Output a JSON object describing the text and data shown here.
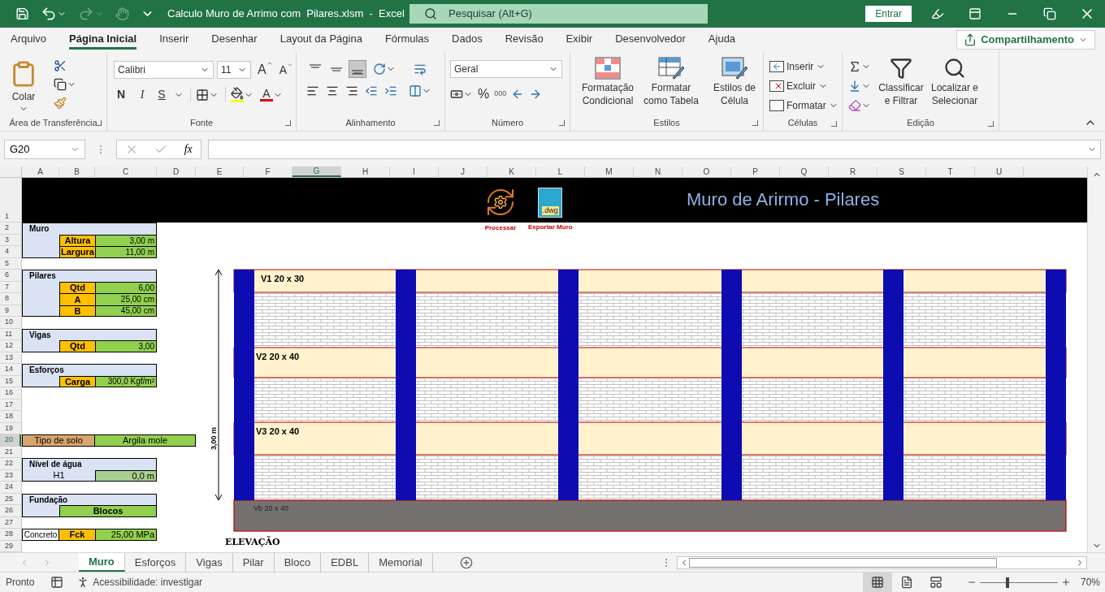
{
  "title_bar": {
    "quick_access": [
      {
        "kind": "save",
        "disabled": false
      },
      {
        "kind": "undo",
        "disabled": false
      },
      {
        "kind": "redo",
        "disabled": true
      },
      {
        "kind": "touch",
        "disabled": true
      },
      {
        "kind": "customize",
        "disabled": false
      }
    ],
    "title": "Calculo Muro de Arrimo com  Pilares.xlsm  -  Excel",
    "search": {
      "placeholder": "Pesquisar (Alt+G)"
    },
    "sign_in": "Entrar"
  },
  "menu_tabs": [
    {
      "label": "Arquivo",
      "selected": false
    },
    {
      "label": "Página Inicial",
      "selected": true
    },
    {
      "label": "Inserir",
      "selected": false
    },
    {
      "label": "Desenhar",
      "selected": false
    },
    {
      "label": "Layout da Página",
      "selected": false
    },
    {
      "label": "Fórmulas",
      "selected": false
    },
    {
      "label": "Dados",
      "selected": false
    },
    {
      "label": "Revisão",
      "selected": false
    },
    {
      "label": "Exibir",
      "selected": false
    },
    {
      "label": "Desenvolvedor",
      "selected": false
    },
    {
      "label": "Ajuda",
      "selected": false
    }
  ],
  "share": "Compartilhamento",
  "ribbon": {
    "clipboard": {
      "paste": "Colar",
      "label": "Área de Transferência"
    },
    "font": {
      "name": "Calibri",
      "size": "11",
      "grow": "A",
      "shrink": "A",
      "bold": "N",
      "italic": "I",
      "underline": "S",
      "color_letter": "A",
      "label": "Fonte"
    },
    "alignment": {
      "vertical": [
        {
          "kind": "top",
          "selected": false
        },
        {
          "kind": "middle",
          "selected": false
        },
        {
          "kind": "bottom",
          "selected": true
        }
      ],
      "label": "Alinhamento"
    },
    "number": {
      "format": "Geral",
      "percent": "%",
      "thousands": "000",
      "label": "Número"
    },
    "styles": {
      "buttons": [
        {
          "kind": "conditional",
          "label": "Formatação Condicional"
        },
        {
          "kind": "table",
          "label": "Formatar como Tabela"
        },
        {
          "kind": "cell",
          "label": "Estilos de Célula"
        }
      ],
      "label": "Estilos"
    },
    "cells": {
      "buttons": [
        {
          "kind": "insert",
          "label": "Inserir"
        },
        {
          "kind": "delete",
          "label": "Excluir"
        },
        {
          "kind": "format",
          "label": "Formatar"
        }
      ],
      "label": "Células"
    },
    "editing": {
      "buttons": [
        {
          "kind": "sort",
          "label": "Classificar e Filtrar"
        },
        {
          "kind": "find",
          "label": "Localizar e Selecionar"
        }
      ],
      "label": "Edição"
    }
  },
  "formula_bar": {
    "name_box": "G20",
    "function_label": "fx"
  },
  "columns": [
    {
      "label": "A",
      "selected": false
    },
    {
      "label": "B",
      "selected": false
    },
    {
      "label": "C",
      "selected": false
    },
    {
      "label": "D",
      "selected": false
    },
    {
      "label": "E",
      "selected": false
    },
    {
      "label": "F",
      "selected": false
    },
    {
      "label": "G",
      "selected": true
    },
    {
      "label": "H",
      "selected": false
    },
    {
      "label": "I",
      "selected": false
    },
    {
      "label": "J",
      "selected": false
    },
    {
      "label": "K",
      "selected": false
    },
    {
      "label": "L",
      "selected": false
    },
    {
      "label": "M",
      "selected": false
    },
    {
      "label": "N",
      "selected": false
    },
    {
      "label": "O",
      "selected": false
    },
    {
      "label": "P",
      "selected": false
    },
    {
      "label": "Q",
      "selected": false
    },
    {
      "label": "R",
      "selected": false
    },
    {
      "label": "S",
      "selected": false
    },
    {
      "label": "T",
      "selected": false
    },
    {
      "label": "U",
      "selected": false
    }
  ],
  "rows": [
    {
      "label": "1",
      "selected": false
    },
    {
      "label": "2",
      "selected": false
    },
    {
      "label": "3",
      "selected": false
    },
    {
      "label": "4",
      "selected": false
    },
    {
      "label": "5",
      "selected": false
    },
    {
      "label": "6",
      "selected": false
    },
    {
      "label": "7",
      "selected": false
    },
    {
      "label": "8",
      "selected": false
    },
    {
      "label": "9",
      "selected": false
    },
    {
      "label": "10",
      "selected": false
    },
    {
      "label": "11",
      "selected": false
    },
    {
      "label": "12",
      "selected": false
    },
    {
      "label": "13",
      "selected": false
    },
    {
      "label": "14",
      "selected": false
    },
    {
      "label": "15",
      "selected": false
    },
    {
      "label": "16",
      "selected": false
    },
    {
      "label": "17",
      "selected": false
    },
    {
      "label": "18",
      "selected": false
    },
    {
      "label": "19",
      "selected": false
    },
    {
      "label": "20",
      "selected": true
    },
    {
      "label": "21",
      "selected": false
    },
    {
      "label": "22",
      "selected": false
    },
    {
      "label": "23",
      "selected": false
    },
    {
      "label": "24",
      "selected": false
    },
    {
      "label": "25",
      "selected": false
    },
    {
      "label": "26",
      "selected": false
    },
    {
      "label": "27",
      "selected": false
    },
    {
      "label": "28",
      "selected": false
    },
    {
      "label": "29",
      "selected": false
    }
  ],
  "sheet": {
    "banner": {
      "title": "Muro de Arirmo - Pilares",
      "buttons": [
        {
          "kind": "process",
          "label": "Processar"
        },
        {
          "kind": "export",
          "label": "Exportar Muro",
          "badge": ".dwg"
        }
      ]
    },
    "form": [
      {
        "kind": "section",
        "label": "Muro"
      },
      {
        "kind": "param",
        "label": "Altura",
        "value": "3,00 m"
      },
      {
        "kind": "param",
        "label": "Largura",
        "value": "11,00 m"
      },
      {
        "kind": "blank"
      },
      {
        "kind": "section",
        "label": "Pilares"
      },
      {
        "kind": "param",
        "label": "Qtd",
        "value": "6,00"
      },
      {
        "kind": "param",
        "label": "A",
        "value": "25,00 cm"
      },
      {
        "kind": "param",
        "label": "B",
        "value": "45,00 cm"
      },
      {
        "kind": "blank"
      },
      {
        "kind": "section",
        "label": "Vigas"
      },
      {
        "kind": "param",
        "label": "Qtd",
        "value": "3,00"
      },
      {
        "kind": "blank"
      },
      {
        "kind": "section",
        "label": "Esforços"
      },
      {
        "kind": "param",
        "label": "Carga",
        "value": "300,0 Kgf/m²"
      },
      {
        "kind": "blank"
      },
      {
        "kind": "blank"
      },
      {
        "kind": "blank"
      },
      {
        "kind": "blank"
      },
      {
        "kind": "choice",
        "label": "Tipo de solo",
        "value": "Argila mole"
      },
      {
        "kind": "blank"
      },
      {
        "kind": "section",
        "label": "Nível de água"
      },
      {
        "kind": "level",
        "label": "H1",
        "value": "0,0 m"
      },
      {
        "kind": "blank"
      },
      {
        "kind": "section",
        "label": "Fundação"
      },
      {
        "kind": "wide",
        "value": "Blocos"
      },
      {
        "kind": "blank"
      },
      {
        "kind": "material",
        "material": "Concreto",
        "label": "Fck",
        "value": "25,00 MPa"
      },
      {
        "kind": "blank"
      }
    ],
    "elevation": {
      "beams": [
        "V1 20 x 30",
        "V2 20 x 40",
        "V3 20 x 40"
      ],
      "base_beam": "Vb 20 x 40",
      "height": "3,00 m",
      "caption": "ELEVAÇÃO"
    }
  },
  "sheet_tabs": [
    {
      "label": "Muro",
      "selected": true
    },
    {
      "label": "Esforços",
      "selected": false
    },
    {
      "label": "Vigas",
      "selected": false
    },
    {
      "label": "Pilar",
      "selected": false
    },
    {
      "label": "Bloco",
      "selected": false
    },
    {
      "label": "EDBL",
      "selected": false
    },
    {
      "label": "Memorial",
      "selected": false
    }
  ],
  "status_bar": {
    "status": "Pronto",
    "accessibility": "Acessibilidade: investigar",
    "views": [
      {
        "kind": "normal",
        "selected": true
      },
      {
        "kind": "page_layout",
        "selected": false
      },
      {
        "kind": "page_break",
        "selected": false
      }
    ],
    "zoom": {
      "level": 0.35,
      "reading": "70%"
    }
  }
}
